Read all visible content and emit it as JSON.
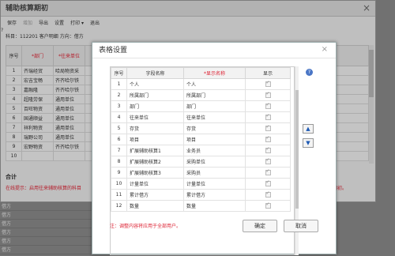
{
  "main": {
    "title": "辅助核算期初",
    "close": "×",
    "toolbar": [
      "保存",
      "增加",
      "导出",
      "设置",
      "打印 ▾",
      "退出"
    ],
    "subject_line": "科目：112201 客户明细 方向：借方",
    "help": "?",
    "headers": [
      "序号",
      "*部门",
      "*往来单位"
    ],
    "rows": [
      [
        "1",
        "齐瑞经贸",
        "哈局物资采"
      ],
      [
        "2",
        "宏吉宝畅",
        "齐齐哈尔铁"
      ],
      [
        "3",
        "嘉融隆",
        "齐齐哈尔铁"
      ],
      [
        "4",
        "超隆劳保",
        "通用单位"
      ],
      [
        "5",
        "百旺物资",
        "通用单位"
      ],
      [
        "6",
        "国通顺益",
        "通用单位"
      ],
      [
        "7",
        "祥利物资",
        "通用单位"
      ],
      [
        "8",
        "瑞野公司",
        "通用单位"
      ],
      [
        "9",
        "宏野物资",
        "齐齐哈尔铁"
      ],
      [
        "10",
        "",
        ""
      ]
    ],
    "sum_label": "合计",
    "tip": "在线提示：启用往来辅助核算的科目",
    "tip_right": "用期初。"
  },
  "background_rows": [
    "借方",
    "借方",
    "借方",
    "借方",
    "借方",
    "借方"
  ],
  "dialog": {
    "title": "表格设置",
    "close": "×",
    "headers": [
      "序号",
      "字段名称",
      "*显示名称",
      "显示"
    ],
    "rows": [
      {
        "no": "1",
        "field": "个人",
        "display": "个人",
        "show": true
      },
      {
        "no": "2",
        "field": "所属部门",
        "display": "所属部门",
        "show": true
      },
      {
        "no": "3",
        "field": "部门",
        "display": "部门",
        "show": true
      },
      {
        "no": "4",
        "field": "往来单位",
        "display": "往来单位",
        "show": true
      },
      {
        "no": "5",
        "field": "存货",
        "display": "存货",
        "show": true
      },
      {
        "no": "6",
        "field": "项目",
        "display": "项目",
        "show": true
      },
      {
        "no": "7",
        "field": "扩展辅助核算1",
        "display": "业务员",
        "show": true
      },
      {
        "no": "8",
        "field": "扩展辅助核算2",
        "display": "采购单位",
        "show": true
      },
      {
        "no": "9",
        "field": "扩展辅助核算3",
        "display": "采购员",
        "show": true
      },
      {
        "no": "10",
        "field": "计量单位",
        "display": "计量单位",
        "show": true
      },
      {
        "no": "11",
        "field": "累计借方",
        "display": "累计借方",
        "show": true
      },
      {
        "no": "12",
        "field": "数量",
        "display": "数量",
        "show": true
      }
    ],
    "move_up": "▲",
    "move_down": "▼",
    "help": "?",
    "note": "注：调整内容将应用于全部用户。",
    "ok": "确定",
    "cancel": "取消"
  }
}
